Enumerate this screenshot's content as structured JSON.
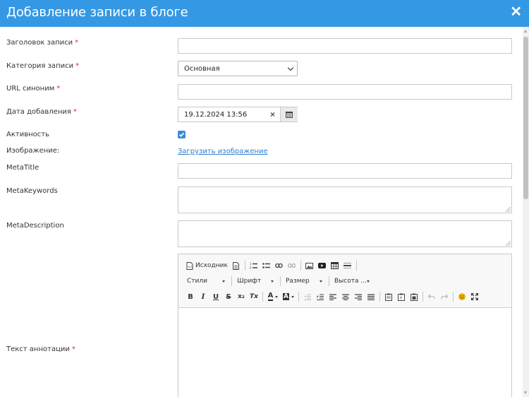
{
  "dialog": {
    "title": "Добавление записи в блоге",
    "close_icon": "close-icon",
    "close_glyph": "✕"
  },
  "form": {
    "title_label": "Заголовок записи",
    "category_label": "Категория записи",
    "category_value": "Основная",
    "url_label": "URL синоним",
    "date_label": "Дата добавления",
    "date_value": "19.12.2024 13:56",
    "active_label": "Активность",
    "active_checked": true,
    "image_label": "Изображение:",
    "image_upload_link": "Загрузить изображение",
    "meta_title_label": "MetaTitle",
    "meta_keywords_label": "MetaKeywords",
    "meta_description_label": "MetaDescription",
    "annotation_label": "Текст аннотации",
    "required_mark": "*"
  },
  "editor": {
    "source_label": "Исходник",
    "styles_label": "Стили",
    "font_label": "Шрифт",
    "size_label": "Размер",
    "height_label": "Высота ...",
    "bold": "B",
    "italic": "I",
    "underline": "U",
    "strike": "S",
    "subscript": "x₂",
    "clear_format": "Tx",
    "text_color": "A",
    "bg_color": "A"
  },
  "colors": {
    "header_bg": "#3598e4",
    "link": "#2f80d0",
    "required": "#e02a2a",
    "checkbox": "#3f8bd8"
  }
}
